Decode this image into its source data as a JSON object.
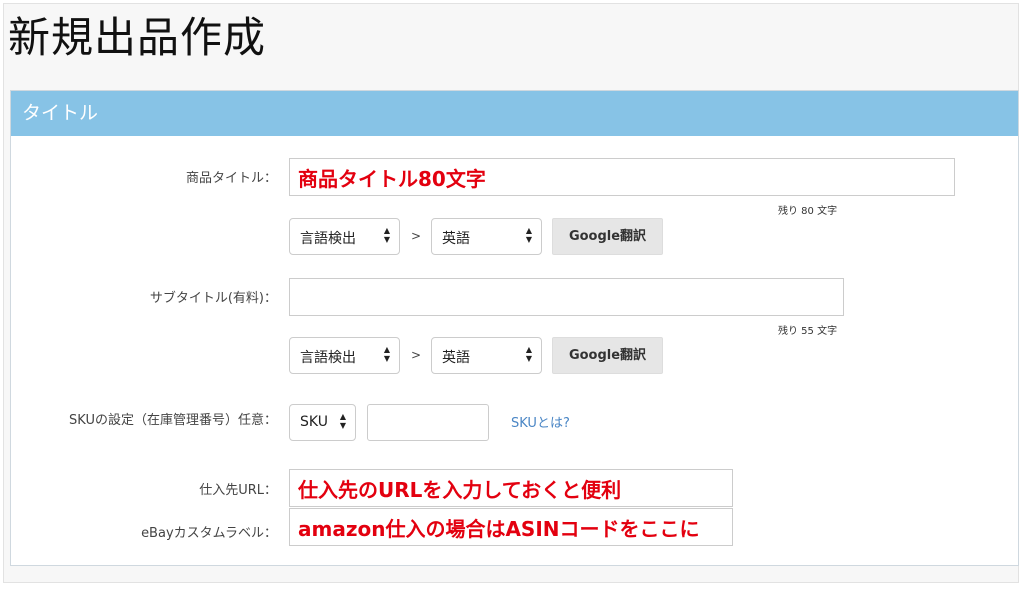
{
  "page": {
    "title": "新規出品作成"
  },
  "section": {
    "title": "タイトル"
  },
  "product_title": {
    "label": "商品タイトル：",
    "value": "商品タイトル80文字",
    "remaining": "残り 80 文字"
  },
  "translate1": {
    "source": "言語検出",
    "separator": ">",
    "target": "英語",
    "button": "Google翻訳"
  },
  "subtitle": {
    "label": "サブタイトル(有料)：",
    "value": "",
    "remaining": "残り 55 文字"
  },
  "translate2": {
    "source": "言語検出",
    "separator": ">",
    "target": "英語",
    "button": "Google翻訳"
  },
  "sku": {
    "label": "SKUの設定（在庫管理番号）任意：",
    "select": "SKU",
    "value": "",
    "link": "SKUとは?"
  },
  "source_url": {
    "label": "仕入先URL：",
    "value": "仕入先のURLを入力しておくと便利"
  },
  "ebay_label": {
    "label": "eBayカスタムラベル：",
    "value": "amazon仕入の場合はASINコードをここに"
  }
}
